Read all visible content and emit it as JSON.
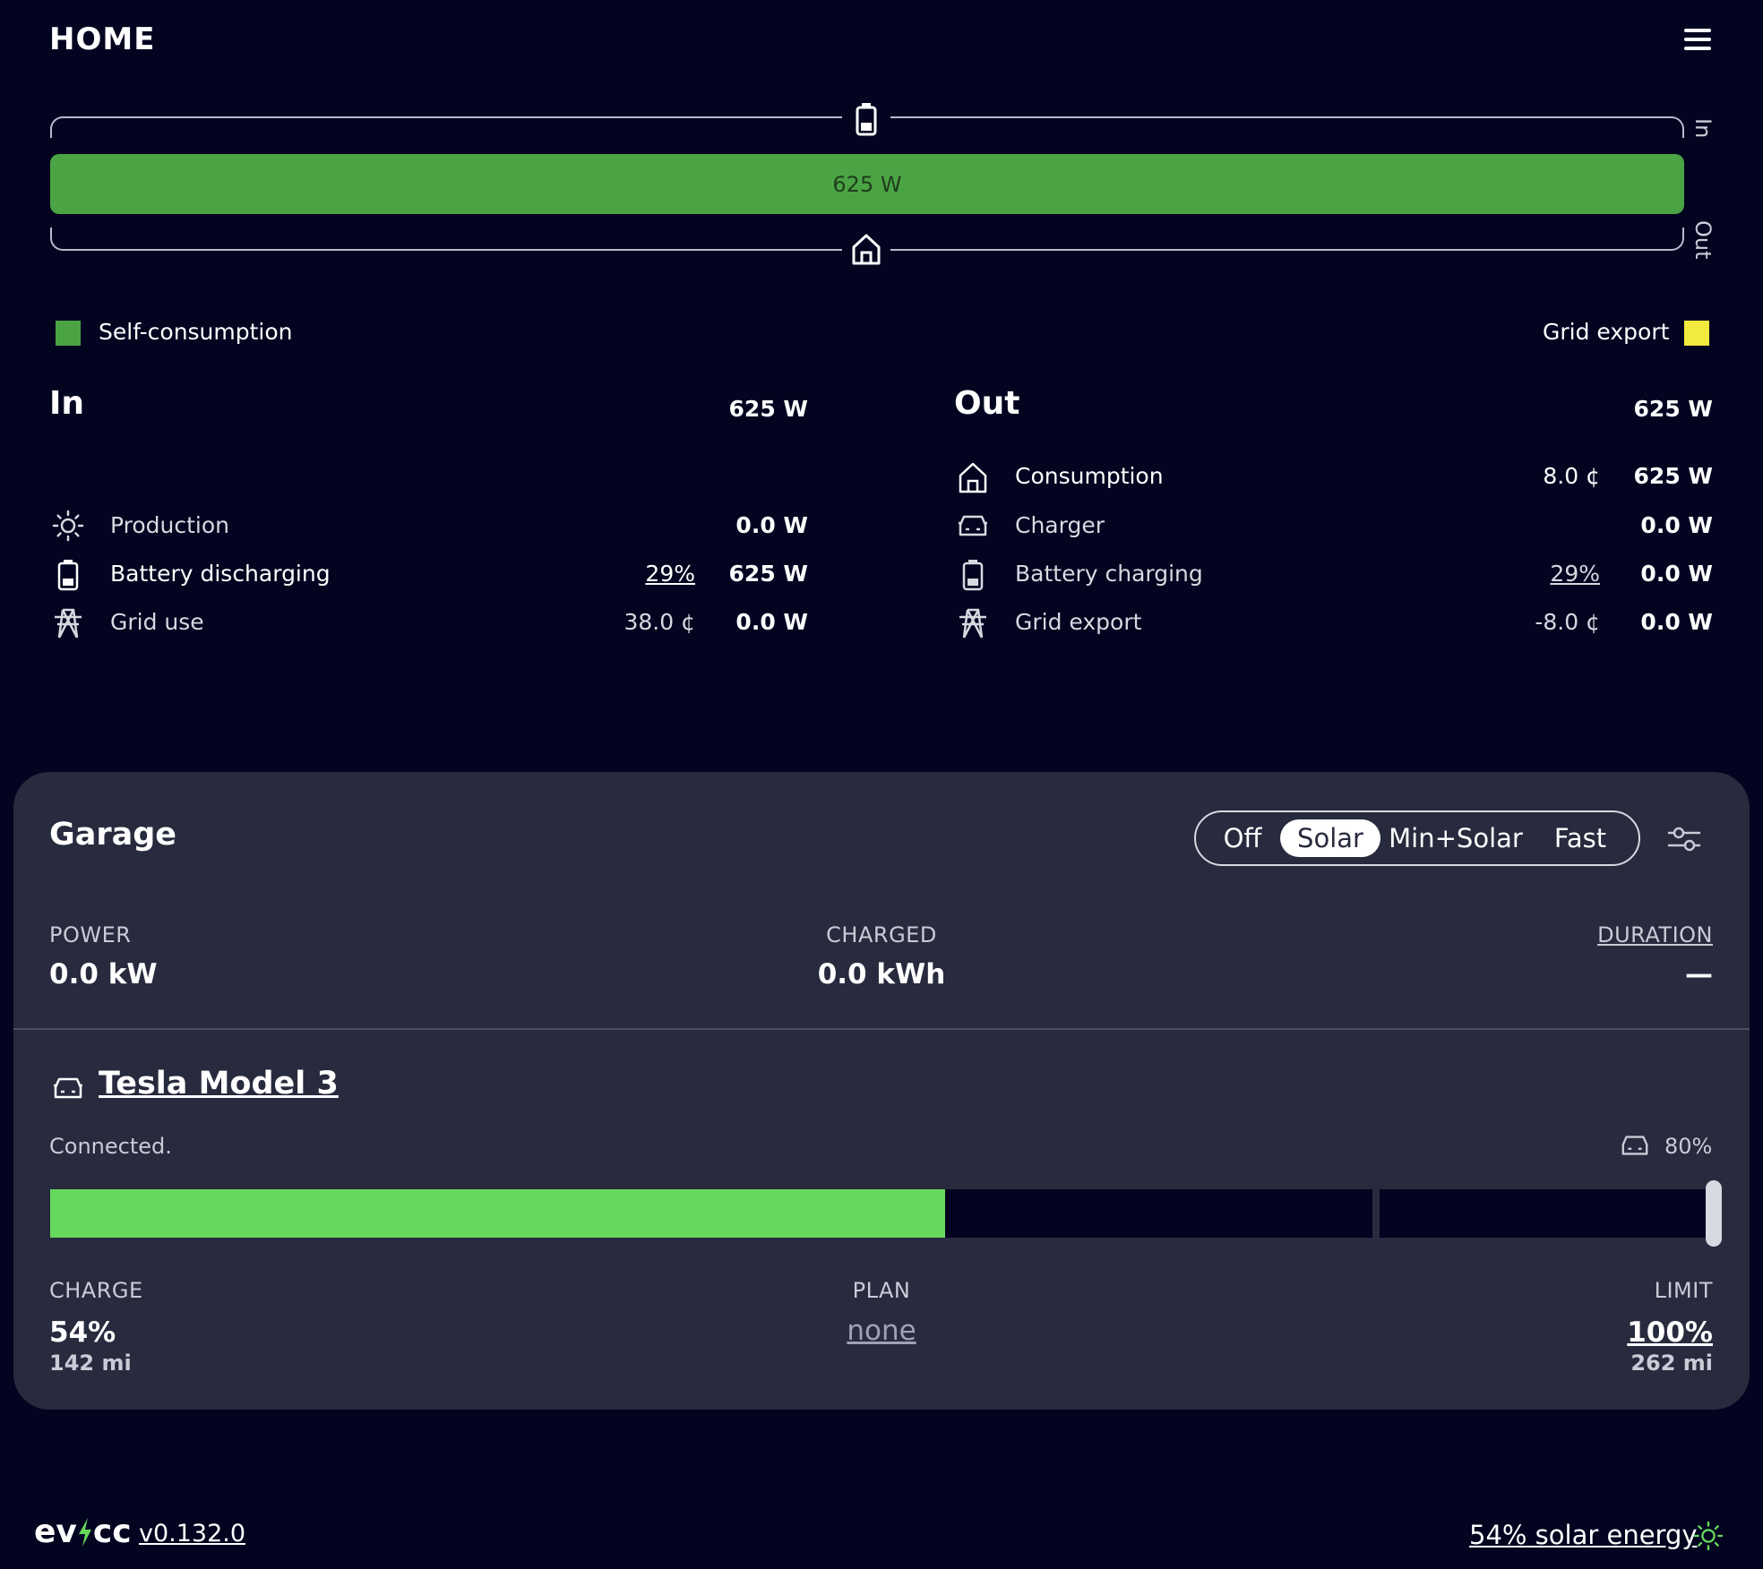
{
  "header": {
    "title": "HOME"
  },
  "flow": {
    "bar_label": "625 W",
    "in_label": "In",
    "out_label": "Out",
    "self_consumption_fraction": 1.0
  },
  "legend": {
    "left": {
      "label": "Self-consumption",
      "color": "#4ba444"
    },
    "right": {
      "label": "Grid export",
      "color": "#f2ea3c"
    }
  },
  "in_table": {
    "title": "In",
    "total": "625 W",
    "rows": [
      {
        "icon": "sun-icon",
        "label": "Production",
        "mid": "",
        "value": "0.0 W"
      },
      {
        "icon": "battery-icon",
        "label": "Battery discharging",
        "mid": "29%",
        "value": "625 W"
      },
      {
        "icon": "grid-tower-icon",
        "label": "Grid use",
        "mid": "38.0 ¢",
        "value": "0.0 W"
      }
    ]
  },
  "out_table": {
    "title": "Out",
    "total": "625 W",
    "rows": [
      {
        "icon": "home-icon",
        "label": "Consumption",
        "mid": "8.0 ¢",
        "value": "625 W"
      },
      {
        "icon": "car-icon",
        "label": "Charger",
        "mid": "",
        "value": "0.0 W"
      },
      {
        "icon": "battery-icon",
        "label": "Battery charging",
        "mid": "29%",
        "value": "0.0 W"
      },
      {
        "icon": "grid-tower-icon",
        "label": "Grid export",
        "mid": "-8.0 ¢",
        "value": "0.0 W"
      }
    ]
  },
  "loadpoint": {
    "title": "Garage",
    "modes": [
      "Off",
      "Solar",
      "Min+Solar",
      "Fast"
    ],
    "active_mode": "Solar",
    "power": {
      "label": "POWER",
      "value": "0.0 kW"
    },
    "charged": {
      "label": "CHARGED",
      "value": "0.0 kWh"
    },
    "duration": {
      "label": "DURATION",
      "value": "—"
    }
  },
  "vehicle": {
    "name": "Tesla Model 3",
    "status": "Connected.",
    "vehicle_limit": "80%",
    "soc_percent": 54,
    "vehicle_limit_percent": 80,
    "charge": {
      "label": "CHARGE",
      "value": "54%",
      "range": "142 mi"
    },
    "plan": {
      "label": "PLAN",
      "value": "none"
    },
    "limit": {
      "label": "LIMIT",
      "value": "100%",
      "range": "262 mi"
    }
  },
  "footer": {
    "brand_left": "ev",
    "brand_right": "cc",
    "version": "v0.132.0",
    "solar_energy": "54% solar energy"
  },
  "colors": {
    "background": "#020420",
    "card": "#282a3e",
    "self_consumption": "#4ba444",
    "soc": "#66d85c",
    "grid_export": "#f2ea3c",
    "solar_icon": "#66d85c"
  }
}
